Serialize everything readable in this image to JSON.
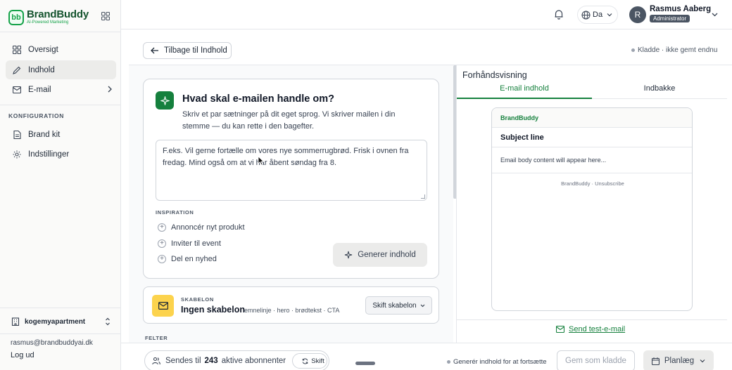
{
  "brand": {
    "name": "BrandBuddy",
    "tagline": "AI-Powered Marketing"
  },
  "sidebar": {
    "items": [
      {
        "label": "Oversigt",
        "icon": "dashboard-icon"
      },
      {
        "label": "Indhold",
        "icon": "pencil-icon",
        "active": true
      },
      {
        "label": "E-mail",
        "icon": "mail-icon"
      }
    ],
    "section_label": "KONFIGURATION",
    "config_items": [
      {
        "label": "Brand kit",
        "icon": "document-icon"
      },
      {
        "label": "Indstillinger",
        "icon": "gear-icon"
      }
    ],
    "workspace": "kogemyapartment",
    "user_email": "rasmus@brandbuddyai.dk",
    "logout": "Log ud"
  },
  "header": {
    "language": "Da",
    "avatar_initial": "R",
    "user_name": "Rasmus Aaberg",
    "user_role": "Administrator"
  },
  "toolbar": {
    "back_label": "Tilbage til Indhold",
    "draft_status": "Kladde · ikke gemt endnu"
  },
  "prompt": {
    "title": "Hvad skal e-mailen handle om?",
    "description": "Skriv et par sætninger på dit eget sprog. Vi skriver mailen i din stemme — du kan rette i den bagefter.",
    "placeholder": "F.eks. Vil gerne fortælle om vores nye sommerrugbrød. Frisk i ovnen fra fredag. Mind også om at vi har åbent søndag fra 8.",
    "inspiration_label": "INSPIRATION",
    "inspiration": [
      "Annoncér nyt produkt",
      "Inviter til event",
      "Del en nyhed"
    ],
    "generate_label": "Generer indhold"
  },
  "template": {
    "kicker": "SKABELON",
    "name": "Ingen skabelon",
    "meta": "emnelinje · hero · brødtekst · CTA",
    "switch_label": "Skift skabelon"
  },
  "fields_label": "FELTER",
  "preview": {
    "title": "Forhåndsvisning",
    "tabs": [
      "E-mail indhold",
      "Indbakke"
    ],
    "active_tab": "E-mail indhold",
    "email_brand": "BrandBuddy",
    "subject": "Subject line",
    "body": "Email body content will appear here...",
    "footer": "BrandBuddy · Unsubscribe",
    "send_test_label": "Send test-e-mail"
  },
  "bottom": {
    "sends_to_label": "Sendes til",
    "subscriber_count": "243",
    "subscribers_label": "aktive abonnenter",
    "swap_label": "Skift",
    "hint": "Generér indhold for at fortsætte",
    "save_draft_label": "Gem som kladde",
    "plan_label": "Planlæg"
  },
  "colors": {
    "accent": "#15803d",
    "template_icon_bg": "#fcd34d",
    "avatar_bg": "#4b5563"
  }
}
